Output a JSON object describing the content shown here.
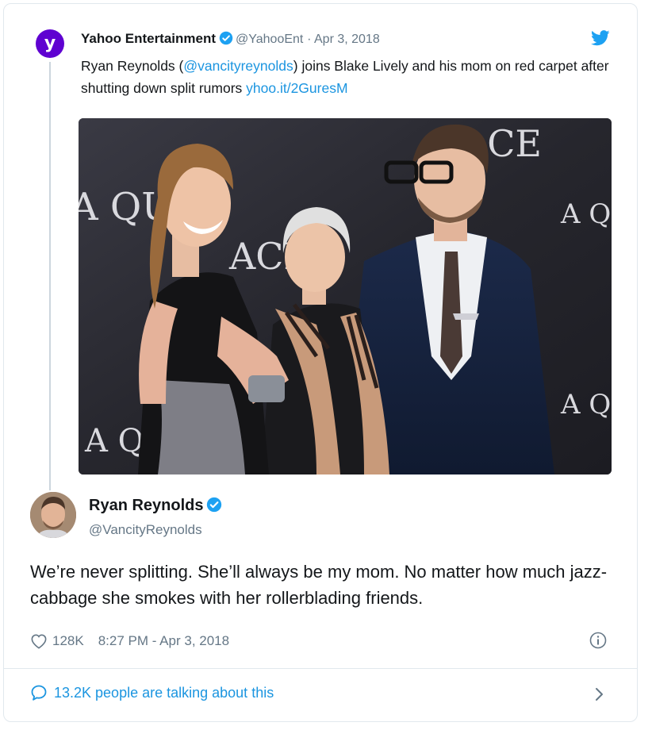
{
  "quoted_tweet": {
    "author_name": "Yahoo Entertainment",
    "handle": "@YahooEnt",
    "date": "· Apr 3, 2018",
    "text_before_mention": "Ryan Reynolds (",
    "mention": "@vancityreynolds",
    "text_after_mention": ") joins Blake Lively and his mom on red carpet after shutting down split rumors ",
    "link": "yhoo.it/2GuresM",
    "avatar_letter": "y",
    "photo_backdrop_text": [
      "ACE",
      "A QU",
      "A Q",
      "ACE",
      "A QU",
      "A QU"
    ]
  },
  "main_tweet": {
    "author_name": "Ryan Reynolds",
    "handle": "@VancityReynolds",
    "text": "We’re never splitting. She’ll always be my mom. No matter how much jazz-cabbage she smokes with her rollerblading friends.",
    "likes": "128K",
    "timestamp": "8:27 PM - Apr 3, 2018"
  },
  "footer": {
    "talking_label": "13.2K people are talking about this"
  },
  "colors": {
    "link": "#1b95e0",
    "verified": "#1da1f2",
    "secondary_text": "#657786",
    "yahoo_purple": "#5f01d1"
  },
  "icons": [
    "verified-badge-icon",
    "twitter-bird-icon",
    "heart-icon",
    "info-icon",
    "speech-bubble-icon",
    "chevron-right-icon"
  ]
}
